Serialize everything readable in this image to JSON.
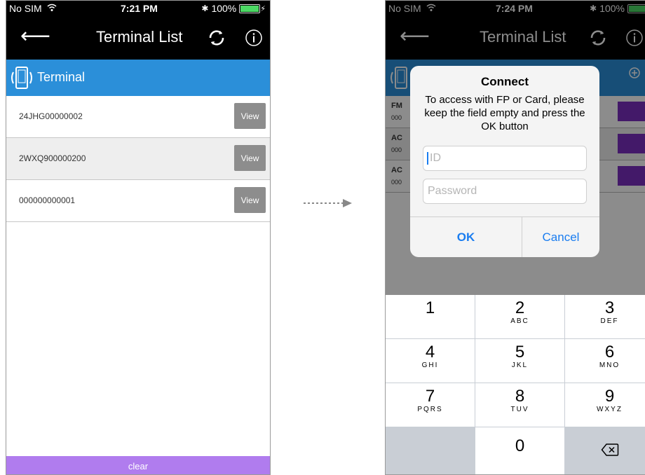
{
  "screen1": {
    "status": {
      "carrier": "No SIM",
      "time": "7:21 PM",
      "battery": "100%"
    },
    "nav": {
      "title": "Terminal List"
    },
    "section": {
      "title": "Terminal"
    },
    "rows": [
      {
        "serial": "24JHG00000002",
        "button": "View"
      },
      {
        "serial": "2WXQ900000200",
        "button": "View"
      },
      {
        "serial": "000000000001",
        "button": "View"
      }
    ],
    "clear_label": "clear"
  },
  "screen2": {
    "status": {
      "carrier": "No SIM",
      "time": "7:24 PM",
      "battery": "100%"
    },
    "nav": {
      "title": "Terminal List"
    },
    "bg_rows": [
      {
        "code": "FM",
        "sub": "000"
      },
      {
        "code": "AC",
        "sub": "000"
      },
      {
        "code": "AC",
        "sub": "000"
      }
    ],
    "dialog": {
      "title": "Connect",
      "message": "To access with FP or Card, please keep the field empty and press the OK button",
      "id_placeholder": "ID",
      "password_placeholder": "Password",
      "ok": "OK",
      "cancel": "Cancel"
    },
    "keypad": [
      {
        "digit": "1",
        "letters": ""
      },
      {
        "digit": "2",
        "letters": "ABC"
      },
      {
        "digit": "3",
        "letters": "DEF"
      },
      {
        "digit": "4",
        "letters": "GHI"
      },
      {
        "digit": "5",
        "letters": "JKL"
      },
      {
        "digit": "6",
        "letters": "MNO"
      },
      {
        "digit": "7",
        "letters": "PQRS"
      },
      {
        "digit": "8",
        "letters": "TUV"
      },
      {
        "digit": "9",
        "letters": "WXYZ"
      },
      {
        "digit": "0",
        "letters": ""
      }
    ]
  },
  "colors": {
    "accent_blue": "#2b8fd9",
    "clear_purple": "#b07cee",
    "link_blue": "#1a7df0"
  }
}
